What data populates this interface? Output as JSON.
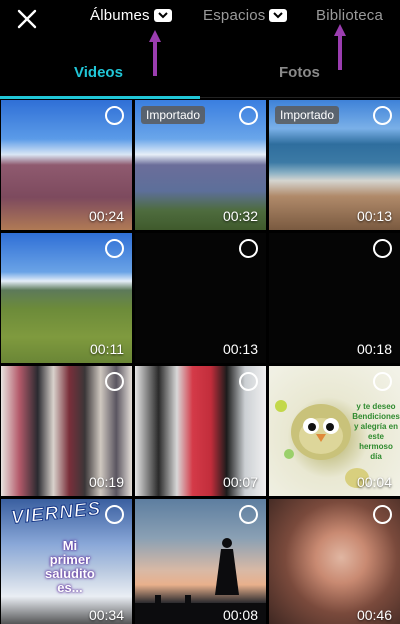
{
  "header": {
    "tabs": [
      {
        "label": "Álbumes"
      },
      {
        "label": "Espacios"
      },
      {
        "label": "Biblioteca"
      }
    ]
  },
  "media_tabs": {
    "videos": "Videos",
    "photos": "Fotos"
  },
  "badge_text": "Importado",
  "tiles": [
    {
      "duration": "00:24",
      "badge": ""
    },
    {
      "duration": "00:32",
      "badge": "Importado"
    },
    {
      "duration": "00:13",
      "badge": "Importado"
    },
    {
      "duration": "00:11",
      "badge": ""
    },
    {
      "duration": "00:13",
      "badge": ""
    },
    {
      "duration": "00:18",
      "badge": ""
    },
    {
      "duration": "00:19",
      "badge": ""
    },
    {
      "duration": "00:07",
      "badge": ""
    },
    {
      "duration": "00:04",
      "badge": ""
    },
    {
      "duration": "00:34",
      "badge": ""
    },
    {
      "duration": "00:08",
      "badge": ""
    },
    {
      "duration": "00:46",
      "badge": ""
    }
  ],
  "thumb_texts": {
    "bird": [
      "y te deseo",
      "Bendiciones",
      "y alegría en",
      "este",
      "hermoso",
      "día"
    ],
    "viernes_title": "VIERNES",
    "viernes_lines": [
      "Mi",
      "primer",
      "saludito",
      "es..."
    ]
  },
  "colors": {
    "accent": "#21c7d8",
    "arrow": "#9b3db0",
    "inactive_tab": "#8a8a8a"
  }
}
